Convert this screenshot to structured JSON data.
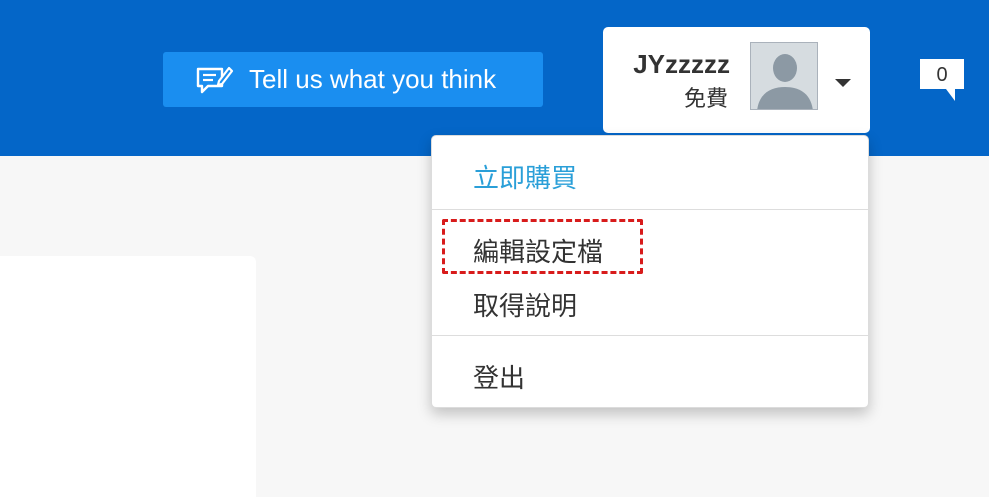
{
  "header": {
    "feedback_label": "Tell us what you think",
    "user_name": "JYzzzzz",
    "user_plan": "免費",
    "notification_count": "0"
  },
  "user_menu": {
    "buy_now": "立即購買",
    "edit_profile": "編輯設定檔",
    "get_help": "取得說明",
    "logout": "登出"
  },
  "colors": {
    "header_bg": "#0466c8",
    "feedback_button_bg": "#1a8ef0",
    "link_blue": "#2a9fd8",
    "highlight_red": "#d81b1b"
  },
  "icons": [
    "feedback-icon",
    "avatar",
    "caret-down-icon",
    "notification-icon"
  ]
}
